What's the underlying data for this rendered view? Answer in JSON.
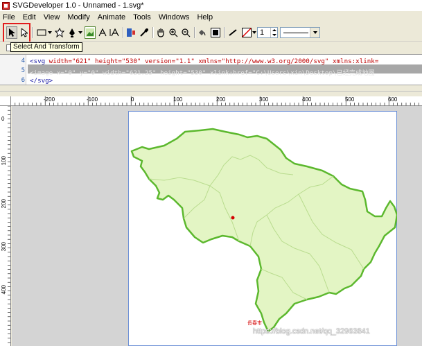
{
  "window": {
    "title": "SVGDeveloper 1.0 - Unnamed - 1.svg*"
  },
  "menu": [
    "File",
    "Edit",
    "View",
    "Modify",
    "Animate",
    "Tools",
    "Windows",
    "Help"
  ],
  "toolbar": {
    "tooltip": "Select And Transform",
    "stroke_width": "1",
    "icons": [
      "select-arrow-icon",
      "direct-select-icon",
      "rectangle-icon",
      "freeform-icon",
      "pen-tool-icon",
      "image-tool-icon",
      "text-tool-icon",
      "text-area-icon",
      "text-path-icon",
      "eyedropper-icon",
      "hand-icon",
      "zoom-in-icon",
      "zoom-out-icon",
      "fill-swatch-icon",
      "stroke-swatch-icon",
      "line-tool-icon",
      "no-color-icon"
    ]
  },
  "editor": {
    "lines": [
      {
        "num": "4",
        "code_tag": "<svg",
        "code_rest": " width=\"621\" height=\"530\" version=\"1.1\" xmlns=\"http://www.w3.org/2000/svg\" xmlns:xlink="
      },
      {
        "num": "5",
        "code_full": "<image x=\"0\" y=\"0\" width=\"621.25\" height=\"530\" xlink:href=\"C:\\Users\\xin\\Desktop\\已经完成地图"
      },
      {
        "num": "6",
        "code_full": "</svg>"
      }
    ]
  },
  "ruler": {
    "h_labels": [
      "-200",
      "-100",
      "0",
      "100",
      "200",
      "300",
      "400",
      "500",
      "600"
    ],
    "v_labels": [
      "0",
      "100",
      "200",
      "300",
      "400"
    ]
  },
  "map": {
    "capital_label": "長春市",
    "fill_color": "#e3f5c4",
    "border_color": "#5cb82e"
  },
  "watermark": "https://blog.csdn.net/qq_32963841"
}
